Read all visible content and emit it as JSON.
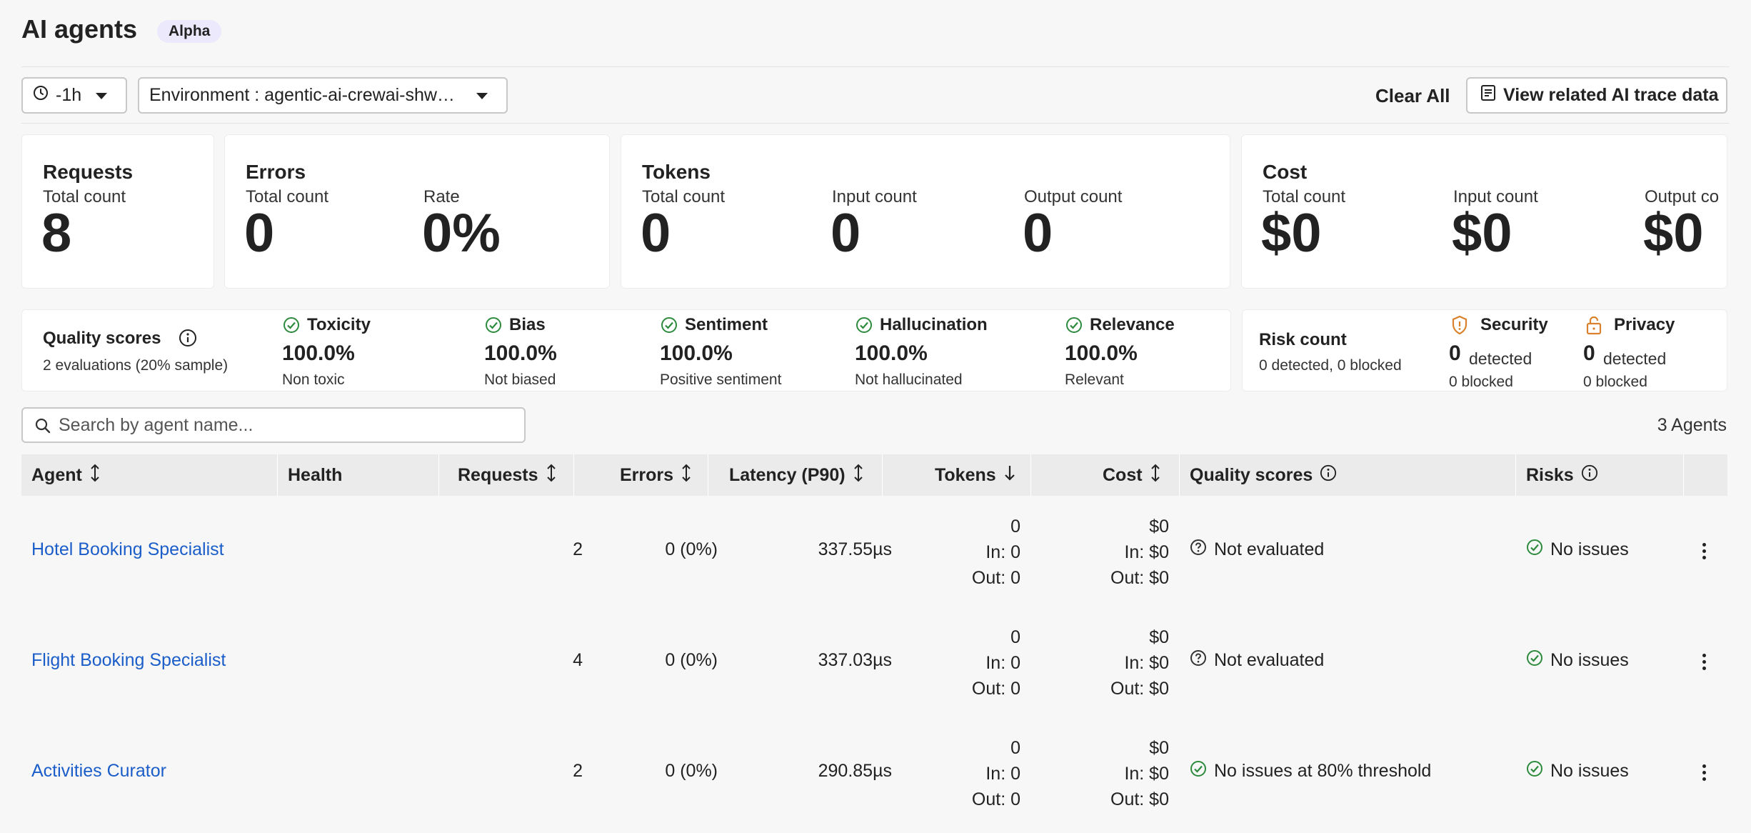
{
  "header": {
    "title": "AI agents",
    "badge": "Alpha"
  },
  "toolbar": {
    "time_range": "-1h",
    "environment": "Environment : agentic-ai-crewai-shw…",
    "clear_all": "Clear All",
    "view_trace": "View related AI trace data"
  },
  "requests": {
    "title": "Requests",
    "total_label": "Total count",
    "total": "8"
  },
  "errors": {
    "title": "Errors",
    "total_label": "Total count",
    "total": "0",
    "rate_label": "Rate",
    "rate": "0%"
  },
  "tokens": {
    "title": "Tokens",
    "total_label": "Total count",
    "total": "0",
    "input_label": "Input count",
    "input": "0",
    "output_label": "Output count",
    "output": "0"
  },
  "cost": {
    "title": "Cost",
    "total_label": "Total count",
    "total": "$0",
    "input_label": "Input count",
    "input": "$0",
    "output_label": "Output co",
    "output": "$0"
  },
  "quality": {
    "title": "Quality scores",
    "subtitle": "2 evaluations (20% sample)",
    "metrics": [
      {
        "name": "Toxicity",
        "value": "100.0%",
        "desc": "Non toxic"
      },
      {
        "name": "Bias",
        "value": "100.0%",
        "desc": "Not biased"
      },
      {
        "name": "Sentiment",
        "value": "100.0%",
        "desc": "Positive sentiment"
      },
      {
        "name": "Hallucination",
        "value": "100.0%",
        "desc": "Not hallucinated"
      },
      {
        "name": "Relevance",
        "value": "100.0%",
        "desc": "Relevant"
      }
    ]
  },
  "risk": {
    "title": "Risk count",
    "subtitle": "0 detected, 0 blocked",
    "security": {
      "name": "Security",
      "count": "0",
      "detected": "detected",
      "blocked": "0 blocked"
    },
    "privacy": {
      "name": "Privacy",
      "count": "0",
      "detected": "detected",
      "blocked": "0 blocked"
    }
  },
  "search": {
    "placeholder": "Search by agent name..."
  },
  "agent_count": "3 Agents",
  "table": {
    "headers": {
      "agent": "Agent",
      "health": "Health",
      "requests": "Requests",
      "errors": "Errors",
      "latency": "Latency (P90)",
      "tokens": "Tokens",
      "cost": "Cost",
      "quality": "Quality scores",
      "risks": "Risks"
    },
    "rows": [
      {
        "agent": "Hotel Booking Specialist",
        "requests": "2",
        "errors": "0 (0%)",
        "latency": "337.55µs",
        "tokens_total": "0",
        "tokens_in": "In: 0",
        "tokens_out": "Out: 0",
        "cost_total": "$0",
        "cost_in": "In: $0",
        "cost_out": "Out: $0",
        "quality": "Not evaluated",
        "risks": "No issues"
      },
      {
        "agent": "Flight Booking Specialist",
        "requests": "4",
        "errors": "0 (0%)",
        "latency": "337.03µs",
        "tokens_total": "0",
        "tokens_in": "In: 0",
        "tokens_out": "Out: 0",
        "cost_total": "$0",
        "cost_in": "In: $0",
        "cost_out": "Out: $0",
        "quality": "Not evaluated",
        "risks": "No issues"
      },
      {
        "agent": "Activities Curator",
        "requests": "2",
        "errors": "0 (0%)",
        "latency": "290.85µs",
        "tokens_total": "0",
        "tokens_in": "In: 0",
        "tokens_out": "Out: 0",
        "cost_total": "$0",
        "cost_in": "In: $0",
        "cost_out": "Out: $0",
        "quality": "No issues at 80% threshold",
        "risks": "No issues"
      }
    ]
  },
  "colors": {
    "link": "#1c5ec9",
    "success": "#2e8b3e",
    "warning": "#d9822b",
    "badge_bg": "#ebe9fb"
  }
}
